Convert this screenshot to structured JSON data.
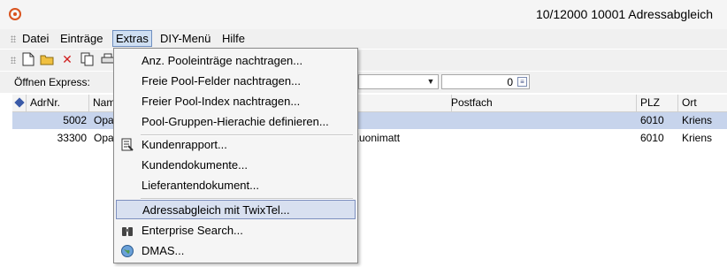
{
  "window": {
    "title": "10/12000   10001  Adressabgleich"
  },
  "menubar": {
    "items": [
      {
        "label": "Datei"
      },
      {
        "label": "Einträge"
      },
      {
        "label": "Extras"
      },
      {
        "label": "DIY-Menü"
      },
      {
        "label": "Hilfe"
      }
    ]
  },
  "toolbar": {
    "icons": [
      "new-icon",
      "open-folder-icon",
      "delete-icon",
      "copy-icon",
      "print-icon"
    ]
  },
  "express": {
    "label": "Öffnen Express:",
    "combo_value": "",
    "number_value": "0"
  },
  "grid": {
    "columns": [
      "AdrNr.",
      "Nam",
      "Postfach",
      "PLZ",
      "Ort"
    ],
    "rows": [
      {
        "adrnr": "5002",
        "name": "Opa",
        "address": "",
        "postfach": "",
        "plz": "6010",
        "ort": "Kriens",
        "selected": true
      },
      {
        "adrnr": "33300",
        "name": "Opa",
        "address": "Kuonimatt",
        "postfach": "",
        "plz": "6010",
        "ort": "Kriens",
        "selected": false
      }
    ]
  },
  "extras_menu": {
    "items": [
      {
        "label": "Anz. Pooleinträge nachtragen...",
        "icon": ""
      },
      {
        "label": "Freie Pool-Felder nachtragen...",
        "icon": ""
      },
      {
        "label": "Freier Pool-Index nachtragen...",
        "icon": ""
      },
      {
        "label": "Pool-Gruppen-Hierachie definieren...",
        "icon": ""
      },
      {
        "label": "Kundenrapport...",
        "icon": "report-icon"
      },
      {
        "label": "Kundendokumente...",
        "icon": ""
      },
      {
        "label": "Lieferantendokument...",
        "icon": ""
      },
      {
        "label": "Adressabgleich mit TwixTel...",
        "icon": "",
        "highlighted": true
      },
      {
        "label": "Enterprise Search...",
        "icon": "binoculars-icon"
      },
      {
        "label": "DMAS...",
        "icon": "globe-icon"
      }
    ]
  },
  "colors": {
    "accent": "#d9531e",
    "selection": "#c7d4ec",
    "menu_highlight": "#d8e0f0"
  }
}
